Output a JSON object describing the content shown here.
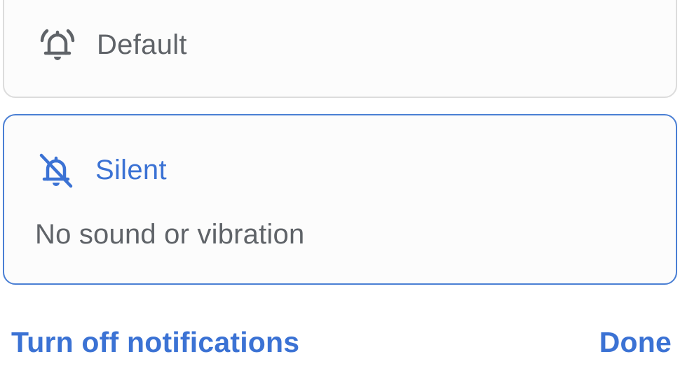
{
  "options": {
    "default": {
      "label": "Default",
      "icon": "bell-ringing-icon",
      "selected": false
    },
    "silent": {
      "label": "Silent",
      "description": "No sound or vibration",
      "icon": "bell-off-icon",
      "selected": true
    }
  },
  "actions": {
    "turn_off_label": "Turn off notifications",
    "done_label": "Done"
  },
  "colors": {
    "accent": "#3b72d4",
    "text_secondary": "#5f6368",
    "card_border": "#dcdcdc",
    "selected_border": "#4a7fd4"
  }
}
